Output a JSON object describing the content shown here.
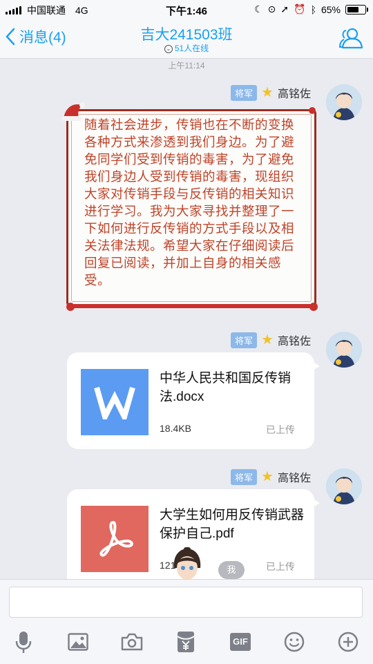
{
  "status_bar": {
    "carrier": "中国联通",
    "network": "4G",
    "time": "下午1:46",
    "battery": "65%"
  },
  "nav": {
    "back_label": "消息(4)",
    "title": "吉大241503班",
    "subtitle": "51人在线"
  },
  "chat": {
    "timestamp": "上午11:14",
    "messages": [
      {
        "badge": "将军",
        "sender": "高铭佐",
        "type": "card",
        "text": "随着社会进步，传销也在不断的变换各种方式来渗透到我们身边。为了避免同学们受到传销的毒害，为了避免我们身边人受到传销的毒害，现组织大家对传销手段与反传销的相关知识进行学习。我为大家寻找并整理了一下如何进行反传销的方式手段以及相关法律法规。希望大家在仔细阅读后回复已阅读，并加上自身的相关感受。"
      },
      {
        "badge": "将军",
        "sender": "高铭佐",
        "type": "file",
        "file_name": "中华人民共和国反传销法.docx",
        "file_size": "18.4KB",
        "file_status": "已上传",
        "icon": "word-doc-icon",
        "color": "#5b9cf2"
      },
      {
        "badge": "将军",
        "sender": "高铭佐",
        "type": "file",
        "file_name": "大学生如何用反传销武器保护自己.pdf",
        "file_size": "121",
        "file_status": "已上传",
        "icon": "pdf-icon",
        "color": "#e0685f"
      }
    ],
    "me_badge": "我"
  },
  "toolbar": {
    "icons": [
      "microphone-icon",
      "image-icon",
      "camera-icon",
      "red-packet-icon",
      "gif-icon",
      "emoji-icon",
      "plus-icon"
    ],
    "gif_label": "GIF"
  },
  "colors": {
    "accent": "#1aa0f1",
    "card_text": "#c0442a",
    "badge": "#8cb8ea"
  }
}
